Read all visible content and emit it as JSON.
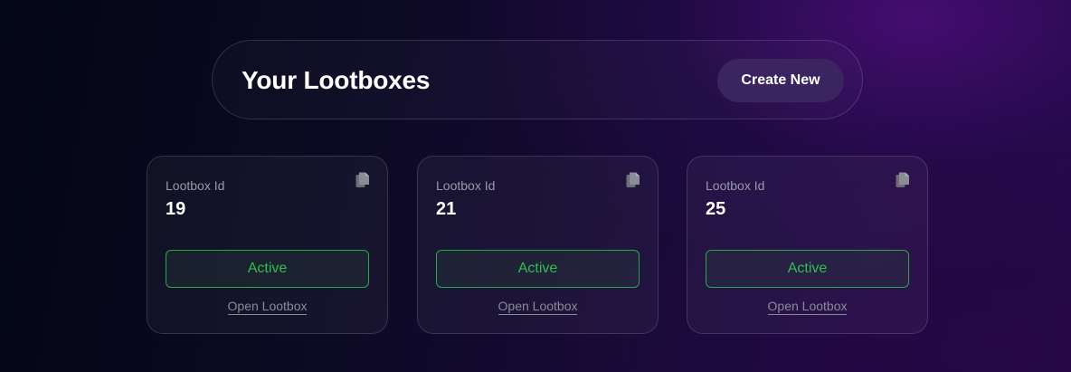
{
  "header": {
    "title": "Your Lootboxes",
    "create_button_label": "Create New"
  },
  "cards": [
    {
      "id_label": "Lootbox Id",
      "id_value": "19",
      "status": "Active",
      "open_label": "Open Lootbox",
      "copy_icon": "copy-icon"
    },
    {
      "id_label": "Lootbox Id",
      "id_value": "21",
      "status": "Active",
      "open_label": "Open Lootbox",
      "copy_icon": "copy-icon"
    },
    {
      "id_label": "Lootbox Id",
      "id_value": "25",
      "status": "Active",
      "open_label": "Open Lootbox",
      "copy_icon": "copy-icon"
    }
  ],
  "colors": {
    "status_active": "#2fbf50",
    "button_bg": "#3b2560"
  }
}
